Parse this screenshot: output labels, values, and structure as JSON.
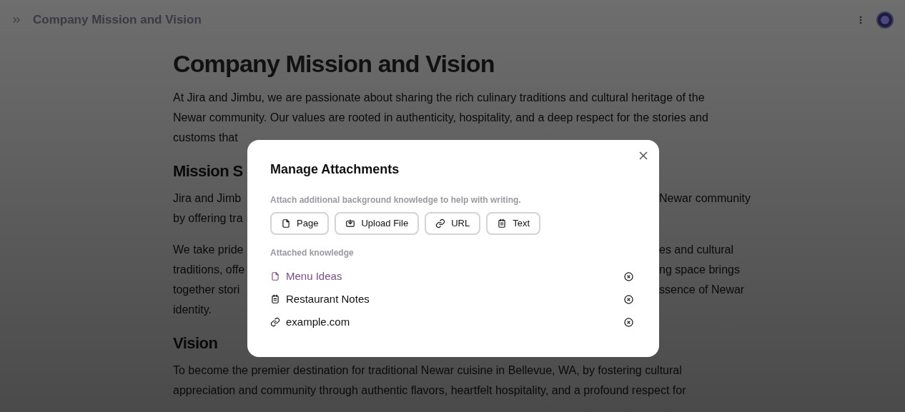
{
  "top_bar": {
    "title": "Company Mission and Vision"
  },
  "document": {
    "title": "Company Mission and Vision",
    "blocks": [
      {
        "kind": "paragraph",
        "lines": [
          {
            "left": "At Jira and Jimbu, we are passionate about sharing the rich culinary traditions and cultural heritage of the"
          },
          {
            "left": "Newar community. Our values are rooted in authenticity, hospitality, and a deep respect for the stories and"
          },
          {
            "left": "customs that"
          }
        ]
      },
      {
        "kind": "heading",
        "text": "Mission S"
      },
      {
        "kind": "paragraph",
        "lines": [
          {
            "left": "Jira and Jimb",
            "right": "Newar community"
          },
          {
            "left": "by offering tra"
          }
        ]
      },
      {
        "kind": "paragraph",
        "lines": [
          {
            "left": "We take pride",
            "right": "es and cultural"
          },
          {
            "left": "traditions, offe",
            "right": "ng space brings"
          },
          {
            "left": "together stori",
            "right": "ssence of Newar"
          },
          {
            "left": "identity."
          }
        ]
      },
      {
        "kind": "heading",
        "text": "Vision"
      },
      {
        "kind": "paragraph",
        "lines": [
          {
            "left": "To become the premier destination for traditional Newar cuisine in Bellevue, WA, by fostering cultural"
          },
          {
            "left": "appreciation and community through authentic flavors, heartfelt hospitality, and a profound respect for"
          }
        ]
      }
    ]
  },
  "dialog": {
    "title": "Manage Attachments",
    "hint": "Attach additional background knowledge to help with writing.",
    "buttons": [
      {
        "kind": "page",
        "label": "Page"
      },
      {
        "kind": "upload",
        "label": "Upload File"
      },
      {
        "kind": "url",
        "label": "URL"
      },
      {
        "kind": "text",
        "label": "Text"
      }
    ],
    "section_label": "Attached knowledge",
    "items": [
      {
        "kind": "page",
        "label": "Menu Ideas",
        "selected": true
      },
      {
        "kind": "text",
        "label": "Restaurant Notes",
        "selected": false
      },
      {
        "kind": "url",
        "label": "example.com",
        "selected": false
      }
    ]
  }
}
